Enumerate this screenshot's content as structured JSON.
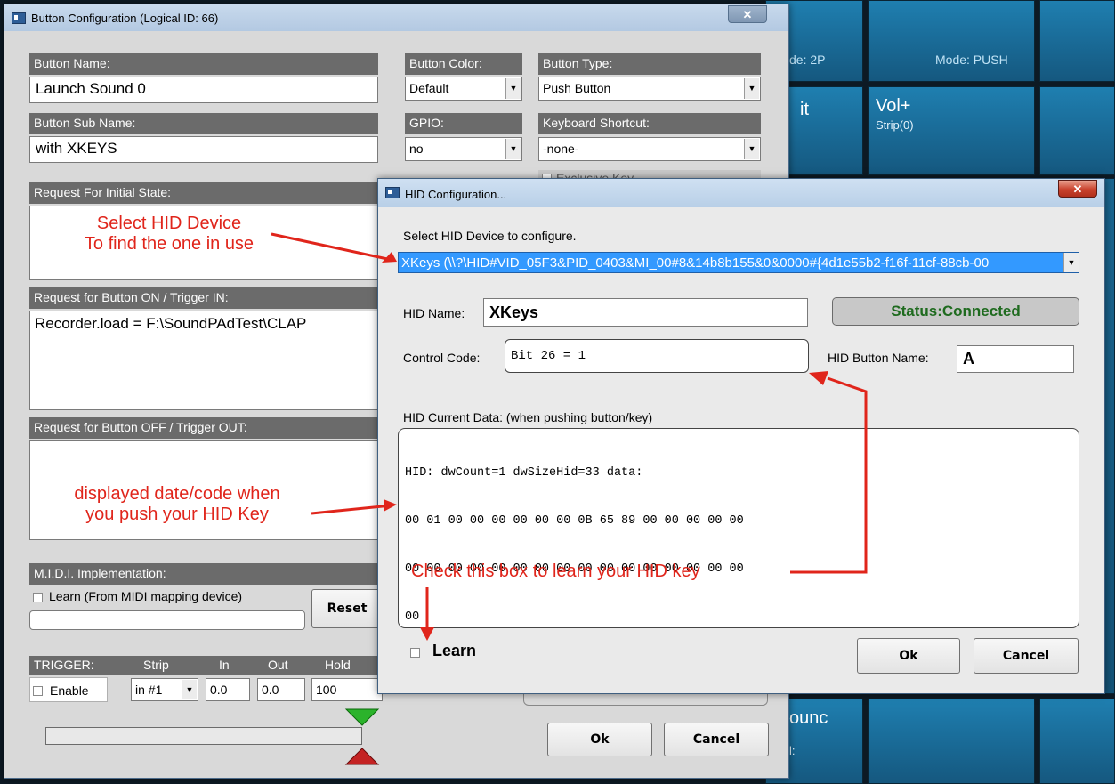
{
  "colors": {
    "accent_red": "#e0251b",
    "status_green": "#1f6b1f",
    "selected_blue": "#3399ff"
  },
  "background_tiles": {
    "mode_left": "de: 2P",
    "mode_right": "Mode: PUSH",
    "tile_left_label": "it",
    "tile_vol_label": "Vol+",
    "tile_vol_sub": "Strip(0)",
    "tile_bottom_label": "ounc",
    "tile_bottom_sub": "l:"
  },
  "button_config": {
    "title": "Button Configuration (Logical ID: 66)",
    "close_icon": "close-icon",
    "button_name_label": "Button Name:",
    "button_name_value": "Launch Sound 0",
    "button_color_label": "Button Color:",
    "button_color_value": "Default",
    "button_type_label": "Button Type:",
    "button_type_value": "Push Button",
    "button_sub_name_label": "Button Sub Name:",
    "button_sub_name_value": "with XKEYS",
    "gpio_label": "GPIO:",
    "gpio_value": "no",
    "keyboard_shortcut_label": "Keyboard Shortcut:",
    "keyboard_shortcut_value": "-none-",
    "exclusive_key_label": "Exclusive Key",
    "request_initial_label": "Request For Initial State:",
    "request_on_label": "Request for Button ON / Trigger IN:",
    "request_on_value": "Recorder.load = F:\\SoundPAdTest\\CLAP",
    "request_off_label": "Request for Button OFF / Trigger OUT:",
    "midi_label": "M.I.D.I. Implementation:",
    "midi_learn_label": "Learn (From MIDI mapping device)",
    "reset_label": "Reset",
    "trigger_label": "TRIGGER:",
    "strip_label": "Strip",
    "in_label": "In",
    "out_label": "Out",
    "hold_label": "Hold",
    "enable_label": "Enable",
    "strip_value": "in #1",
    "in_value": "0.0",
    "out_value": "0.0",
    "hold_value": "100",
    "ok_label": "Ok",
    "cancel_label": "Cancel"
  },
  "hid_config": {
    "title": "HID Configuration...",
    "close_icon": "close-icon",
    "select_label": "Select HID Device to configure.",
    "selected_device": "XKeys (\\\\?\\HID#VID_05F3&PID_0403&MI_00#8&14b8b155&0&0000#{4d1e55b2-f16f-11cf-88cb-00",
    "hid_name_label": "HID Name:",
    "hid_name_value": "XKeys",
    "status": "Status:Connected",
    "control_code_label": "Control Code:",
    "control_code_value": "Bit 26 = 1",
    "hid_button_name_label": "HID Button Name:",
    "hid_button_name_value": "A",
    "current_data_label": "HID Current Data: (when pushing button/key)",
    "current_data_lines": [
      "HID: dwCount=1 dwSizeHid=33 data:",
      "00 01 00 00 00 00 00 00 0B 65 89 00 00 00 00 00",
      "00 00 00 00 00 00 00 00 00 00 00 00 00 00 00 00",
      "00"
    ],
    "learn_label": "Learn",
    "ok_label": "Ok",
    "cancel_label": "Cancel"
  },
  "annotations": {
    "select_device_line1": "Select HID Device",
    "select_device_line2": "To find the one in use",
    "displayed_line1": "displayed date/code when",
    "displayed_line2": "you push your HID Key",
    "check_box_note": "Check this box to learn your HID key"
  }
}
